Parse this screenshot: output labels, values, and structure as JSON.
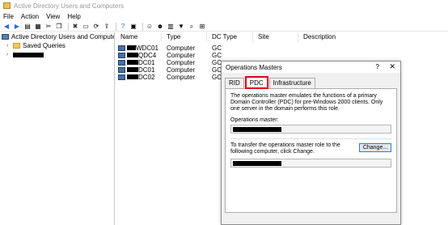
{
  "window": {
    "title": "Active Directory Users and Computers"
  },
  "menu": [
    "File",
    "Action",
    "View",
    "Help"
  ],
  "toolbar_icons": [
    "back-icon",
    "forward-icon",
    "up-icon",
    "show-console-tree-icon",
    "cut-icon",
    "copy-icon",
    "delete-icon",
    "properties-icon",
    "refresh-icon",
    "export-icon",
    "help-icon",
    "console-icon",
    "add-user-icon",
    "add-group-icon",
    "add-ou-icon",
    "filter-icon",
    "find-icon",
    "add-to-group-icon"
  ],
  "tree": {
    "root_label": "Active Directory Users and Computers [lhh",
    "saved_queries": "Saved Queries",
    "domain_expander": "›"
  },
  "list": {
    "columns": [
      "Name",
      "Type",
      "DC Type",
      "Site",
      "Description"
    ],
    "rows": [
      {
        "name": "WDC01",
        "type": "Computer",
        "dc_type": "GC"
      },
      {
        "name": "QDC4",
        "type": "Computer",
        "dc_type": "GC"
      },
      {
        "name": "DC01",
        "type": "Computer",
        "dc_type": "GC"
      },
      {
        "name": "DC01",
        "type": "Computer",
        "dc_type": "GC"
      },
      {
        "name": "DC02",
        "type": "Computer",
        "dc_type": "GC"
      }
    ]
  },
  "dialog": {
    "title": "Operations Masters",
    "help": "?",
    "close": "✕",
    "tabs": [
      "RID",
      "PDC",
      "Infrastructure"
    ],
    "active_tab": "PDC",
    "description": "The operations master emulates the functions of a primary Domain Controller (PDC) for pre-Windows 2000 clients. Only one server in the domain performs this role.",
    "operations_master_label": "Operations master:",
    "transfer_text": "To transfer the operations master role to the following computer, click Change.",
    "change_button": "Change...",
    "highlight_color": "#e0001a"
  }
}
